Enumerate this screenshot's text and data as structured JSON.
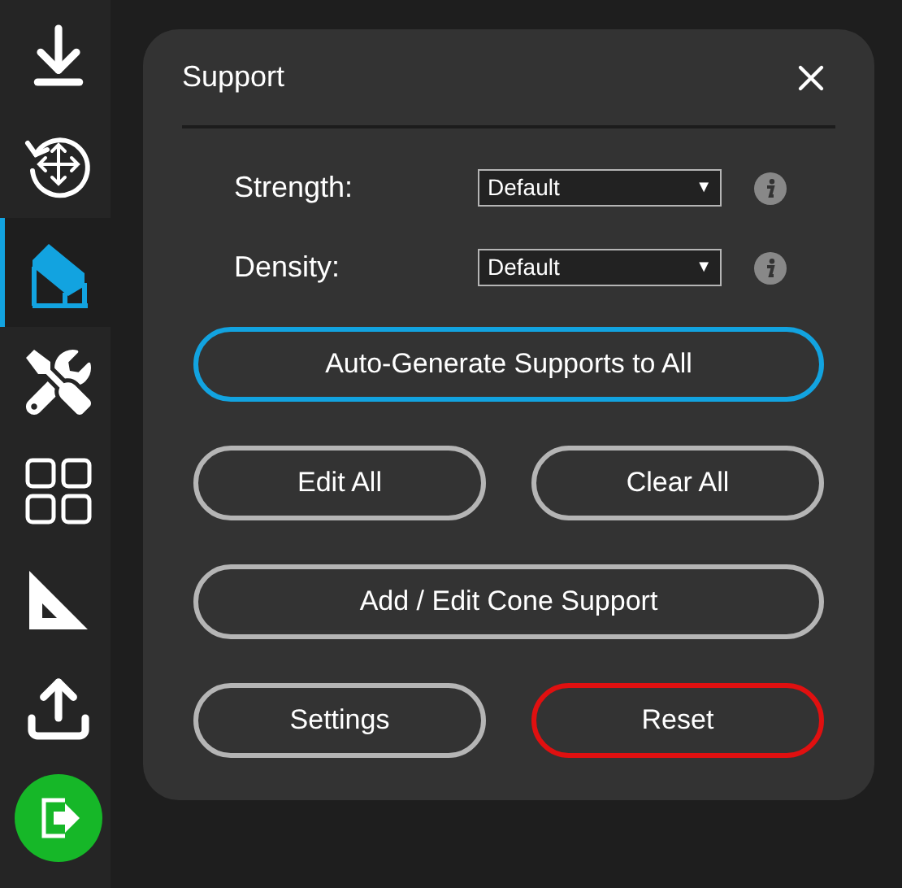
{
  "sidebar": {
    "items": [
      {
        "kind": "download",
        "selected": false
      },
      {
        "kind": "rotate-move",
        "selected": false
      },
      {
        "kind": "support",
        "selected": true
      },
      {
        "kind": "tools",
        "selected": false
      },
      {
        "kind": "grid",
        "selected": false
      },
      {
        "kind": "ruler",
        "selected": false
      },
      {
        "kind": "upload",
        "selected": false
      },
      {
        "kind": "exit",
        "selected": false
      }
    ]
  },
  "panel": {
    "title": "Support",
    "fields": [
      {
        "label": "Strength:",
        "value": "Default",
        "arrow": "▼"
      },
      {
        "label": "Density:",
        "value": "Default",
        "arrow": "▼"
      }
    ],
    "button_rows": [
      [
        {
          "label": "Auto-Generate Supports to All",
          "kind": "primary"
        }
      ],
      [
        {
          "label": "Edit All",
          "kind": "default"
        },
        {
          "label": "Clear All",
          "kind": "default"
        }
      ],
      [
        {
          "label": "Add / Edit Cone Support",
          "kind": "default"
        }
      ],
      [
        {
          "label": "Settings",
          "kind": "default"
        },
        {
          "label": "Reset",
          "kind": "danger"
        }
      ]
    ]
  }
}
